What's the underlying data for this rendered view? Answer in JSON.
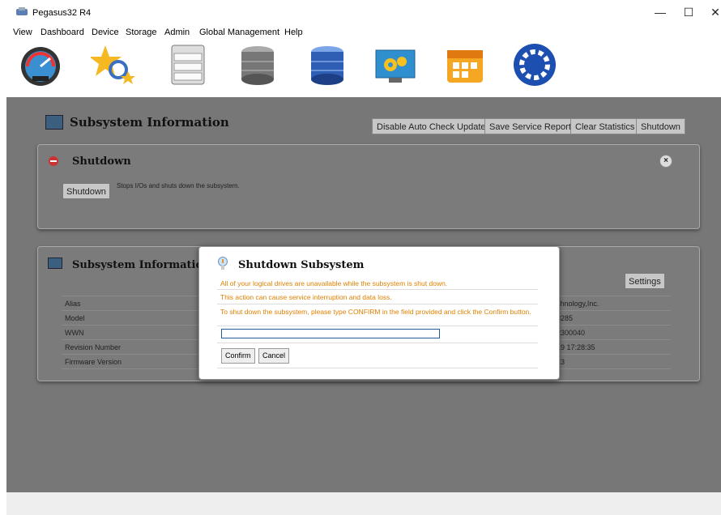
{
  "window": {
    "title": "Pegasus32 R4",
    "minimize": "—",
    "maximize": "☐",
    "close": "✕"
  },
  "menu": [
    "View",
    "Dashboard",
    "Device",
    "Storage",
    "Admin",
    "Global Management",
    "Help"
  ],
  "toolbar_icons": [
    "dashboard-gauge-icon",
    "wizard-star-icon",
    "device-enclosure-icon",
    "storage-gray-drives-icon",
    "storage-blue-drives-icon",
    "admin-gears-icon",
    "calendar-icon",
    "refresh-spinner-icon"
  ],
  "header": {
    "title": "Subsystem Information",
    "buttons": [
      "Disable Auto Check Update",
      "Save Service Report",
      "Clear Statistics",
      "Shutdown"
    ]
  },
  "shutdown_panel": {
    "title": "Shutdown",
    "button": "Shutdown",
    "description": "Stops I/Os and shuts down the subsystem.",
    "close": "×"
  },
  "info_panel": {
    "title": "Subsystem Information",
    "settings_button": "Settings",
    "rows": [
      {
        "label": "Alias",
        "value": ""
      },
      {
        "label": "Model",
        "value": "chnology,Inc."
      },
      {
        "label": "WWN",
        "value": "3285"
      },
      {
        "label": "Revision Number",
        "value": "2300040"
      },
      {
        "label": "Firmware Version",
        "value": "19 17:28:35"
      }
    ],
    "extra_value": "t 3"
  },
  "dialog": {
    "title": "Shutdown Subsystem",
    "warning1": "All of your logical drives are unavailable while the subsystem is shut down.",
    "warning2": "This action can cause service interruption and data loss.",
    "warning3": "To shut down the subsystem, please type CONFIRM in the field provided and click the Confirm button.",
    "input_value": "",
    "confirm": "Confirm",
    "cancel": "Cancel"
  },
  "colors": {
    "overlay": "#777777",
    "warning": "#e08000",
    "accent": "#2a5a9a"
  }
}
